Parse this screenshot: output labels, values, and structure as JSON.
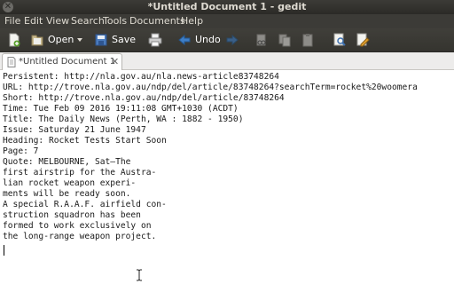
{
  "window": {
    "title": "*Untitled Document 1 - gedit",
    "close_glyph": "✕"
  },
  "menu": [
    "File",
    "Edit",
    "View",
    "Search",
    "Tools",
    "Documents",
    "Help"
  ],
  "toolbar": {
    "open_label": "Open",
    "save_label": "Save",
    "undo_label": "Undo"
  },
  "tab": {
    "label": "*Untitled Document 1",
    "close_glyph": "✕"
  },
  "document": {
    "lines": [
      "Persistent: http://nla.gov.au/nla.news-article83748264",
      "URL: http://trove.nla.gov.au/ndp/del/article/83748264?searchTerm=rocket%20woomera",
      "Short: http://trove.nla.gov.au/ndp/del/article/83748264",
      "Time: Tue Feb 09 2016 19:11:08 GMT+1030 (ACDT)",
      "Title: The Daily News (Perth, WA : 1882 - 1950)",
      "Issue: Saturday 21 June 1947",
      "Heading: Rocket Tests Start Soon",
      "Page: 7",
      "Quote: MELBOURNE, Sat—The",
      "first airstrip for the Austra-",
      "lian rocket weapon experi-",
      "ments will be ready soon.",
      "A special R.A.A.F. airfield con-",
      "struction squadron has been",
      "formed to work exclusively on",
      "the long-range weapon project."
    ]
  }
}
